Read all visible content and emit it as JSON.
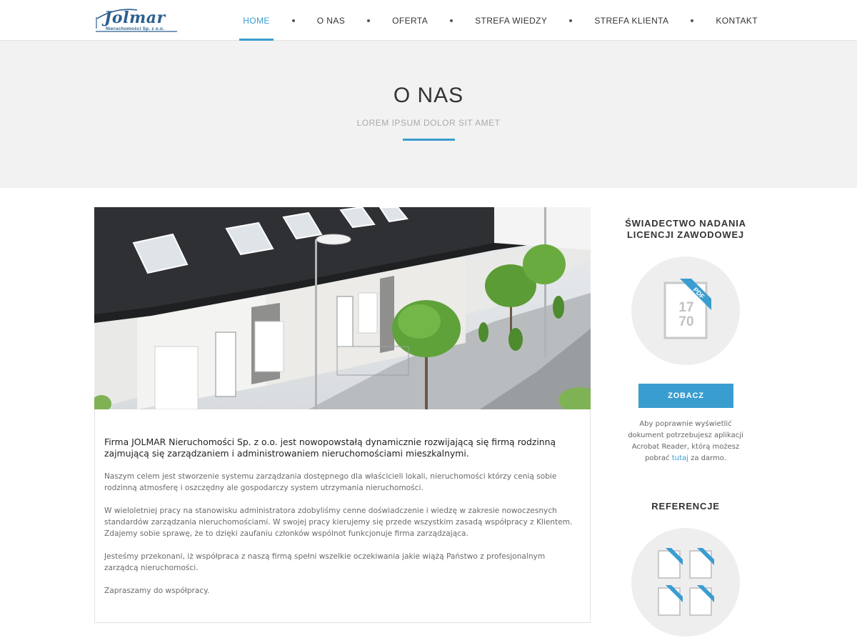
{
  "header": {
    "logo_word": "Jolmar",
    "logo_subtitle": "Nieruchomości Sp. z o.o.",
    "nav": [
      {
        "label": "HOME",
        "active": true
      },
      {
        "label": "O NAS",
        "active": false
      },
      {
        "label": "OFERTA",
        "active": false
      },
      {
        "label": "STREFA WIEDZY",
        "active": false
      },
      {
        "label": "STREFA KLIENTA",
        "active": false
      },
      {
        "label": "KONTAKT",
        "active": false
      }
    ]
  },
  "page": {
    "title": "O NAS",
    "subtitle": "LOREM IPSUM DOLOR SIT AMET"
  },
  "main": {
    "lead": "Firma  JOLMAR Nieruchomości Sp. z o.o. jest nowopowstałą dynamicznie rozwijającą się firmą rodzinną zajmującą się zarządzaniem i administrowaniem nieruchomościami mieszkalnymi.",
    "paragraphs": [
      "Naszym celem jest stworzenie systemu zarządzania dostępnego dla właścicieli lokali, nieruchomości którzy cenią sobie rodzinną atmosferę i oszczędny ale gospodarczy system utrzymania nieruchomości.",
      "W wieloletniej pracy na stanowisku administratora zdobyliśmy cenne doświadczenie i wiedzę w zakresie nowoczesnych  standardów zarządzania nieruchomościami.  W swojej pracy kierujemy się przede wszystkim zasadą współpracy z Klientem. Zdajemy sobie sprawę, że to dzięki zaufaniu członków wspólnot funkcjonuje firma zarządzająca.",
      "Jesteśmy przekonani, iż współpraca z naszą firmą spełni wszelkie oczekiwania jakie wiążą Państwo z profesjonalnym zarządcą nieruchomości.",
      "Zapraszamy do współpracy."
    ]
  },
  "sidebar": {
    "license_title_1": "ŚWIADECTWO NADANIA",
    "license_title_2": "LICENCJI ZAWODOWEJ",
    "pdf_badge": "PDF",
    "pdf_num_1": "17",
    "pdf_num_2": "70",
    "button": "ZOBACZ",
    "note_before": "Aby poprawnie wyświetlić dokument potrzebujesz aplikacji Acrobat Reader, którą możesz pobrać ",
    "note_link": "tutaj",
    "note_after": " za darmo.",
    "references_title": "REFERENCJE"
  },
  "colors": {
    "accent": "#3a9dd0",
    "band": "#f2f2f2",
    "logo": "#2b5f8f"
  }
}
